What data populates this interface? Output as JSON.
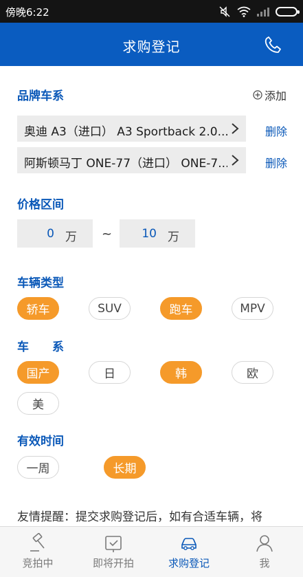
{
  "status_bar": {
    "time": "傍晚6:22"
  },
  "header": {
    "title": "求购登记"
  },
  "brand_section": {
    "title": "品牌车系",
    "add_label": "添加",
    "delete_label": "删除",
    "items": [
      {
        "label": "奥迪 A3（进口） A3 Sportback 2.0..."
      },
      {
        "label": "阿斯顿马丁 ONE-77（进口） ONE-7..."
      }
    ]
  },
  "price_section": {
    "title": "价格区间",
    "min": "0",
    "max": "10",
    "unit": "万",
    "separator": "~"
  },
  "vehicle_type_section": {
    "title": "车辆类型",
    "options": [
      {
        "label": "轿车",
        "selected": true
      },
      {
        "label": "SUV",
        "selected": false
      },
      {
        "label": "跑车",
        "selected": true
      },
      {
        "label": "MPV",
        "selected": false
      }
    ]
  },
  "series_section": {
    "title": "车　　系",
    "options": [
      {
        "label": "国产",
        "selected": true
      },
      {
        "label": "日",
        "selected": false
      },
      {
        "label": "韩",
        "selected": true
      },
      {
        "label": "欧",
        "selected": false
      },
      {
        "label": "美",
        "selected": false
      }
    ]
  },
  "validity_section": {
    "title": "有效时间",
    "options": [
      {
        "label": "一周",
        "selected": false
      },
      {
        "label": "长期",
        "selected": true
      }
    ]
  },
  "notice": "友情提醒：提交求购登记后，如有合适车辆，将",
  "tab_bar": {
    "tabs": [
      {
        "label": "竞拍中",
        "icon": "gavel-icon"
      },
      {
        "label": "即将开拍",
        "icon": "calendar-check-icon"
      },
      {
        "label": "求购登记",
        "icon": "car-icon",
        "active": true
      },
      {
        "label": "我",
        "icon": "user-icon"
      }
    ]
  },
  "colors": {
    "primary": "#0a5cc0",
    "accent": "#f59a2a",
    "status_bar": "#141414"
  }
}
